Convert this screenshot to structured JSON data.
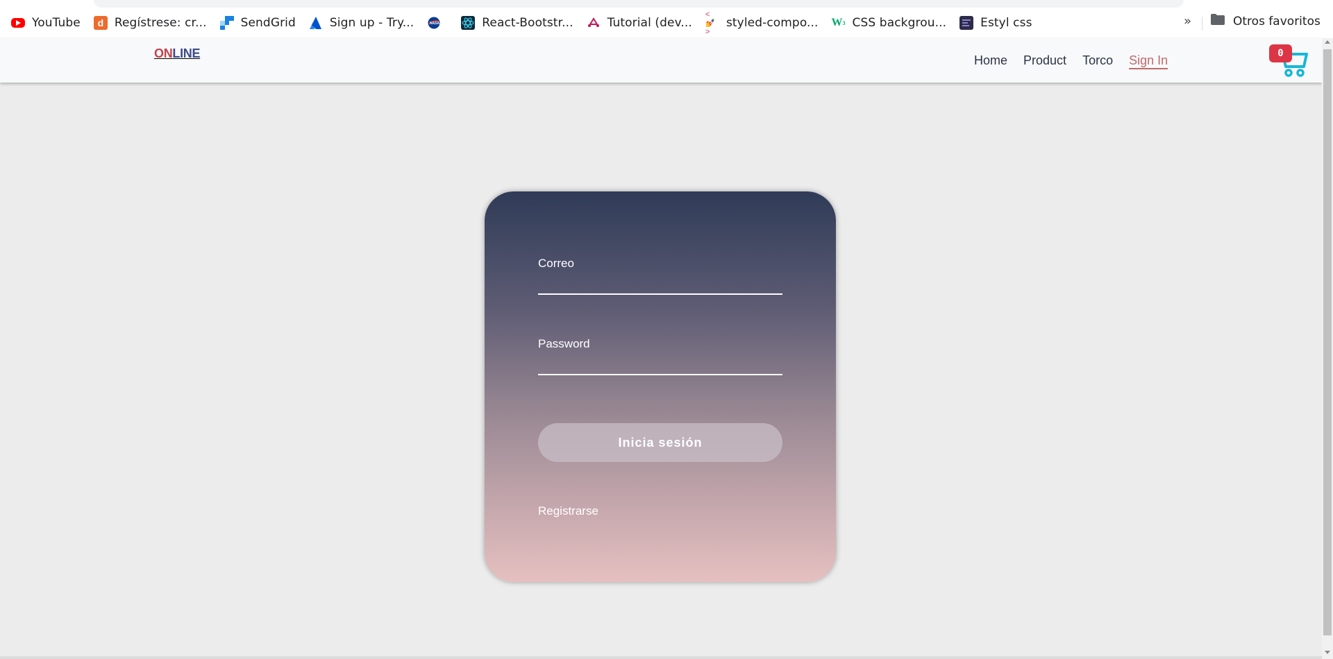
{
  "bookmarks": {
    "items": [
      {
        "label": "YouTube",
        "icon": "youtube-icon",
        "color": "#ff0000"
      },
      {
        "label": "Regístrese: cr...",
        "icon": "d-letter-icon",
        "color": "#ee6b2d"
      },
      {
        "label": "SendGrid",
        "icon": "sendgrid-icon",
        "color": "#1a82e2"
      },
      {
        "label": "Sign up - Try...",
        "icon": "atlassian-icon",
        "color": "#2684ff"
      },
      {
        "label": "",
        "icon": "nasa-icon",
        "color": "#0b3d91"
      },
      {
        "label": "React-Bootstr...",
        "icon": "react-bootstrap-icon",
        "color": "#0d2b3e"
      },
      {
        "label": "Tutorial (dev...",
        "icon": "tutorial-icon",
        "color": "#c2185b"
      },
      {
        "label": "styled-compo...",
        "icon": "styled-components-icon",
        "color": "#db7093"
      },
      {
        "label": "CSS backgrou...",
        "icon": "w3schools-icon",
        "color": "#04aa6d"
      },
      {
        "label": "Estyl css",
        "icon": "site-thumbnail-icon",
        "color": "#2d2a4a"
      }
    ],
    "more": "»",
    "other_folder": "Otros favoritos"
  },
  "navbar": {
    "brand_part1": "ON",
    "brand_part2": "LINE",
    "links": [
      {
        "label": "Home"
      },
      {
        "label": "Product"
      },
      {
        "label": "Torco"
      },
      {
        "label": "Sign In",
        "active": true
      }
    ],
    "cart_count": "0"
  },
  "login": {
    "email_label": "Correo",
    "email_value": "",
    "password_label": "Password",
    "password_value": "",
    "submit_label": "Inicia sesión",
    "register_link": "Registrarse"
  },
  "colors": {
    "cart": "#17b6d9",
    "badge": "#dc3545",
    "active_link": "#c06a6a",
    "brand_on": "#c1444d",
    "brand_line": "#3b4a8a"
  }
}
